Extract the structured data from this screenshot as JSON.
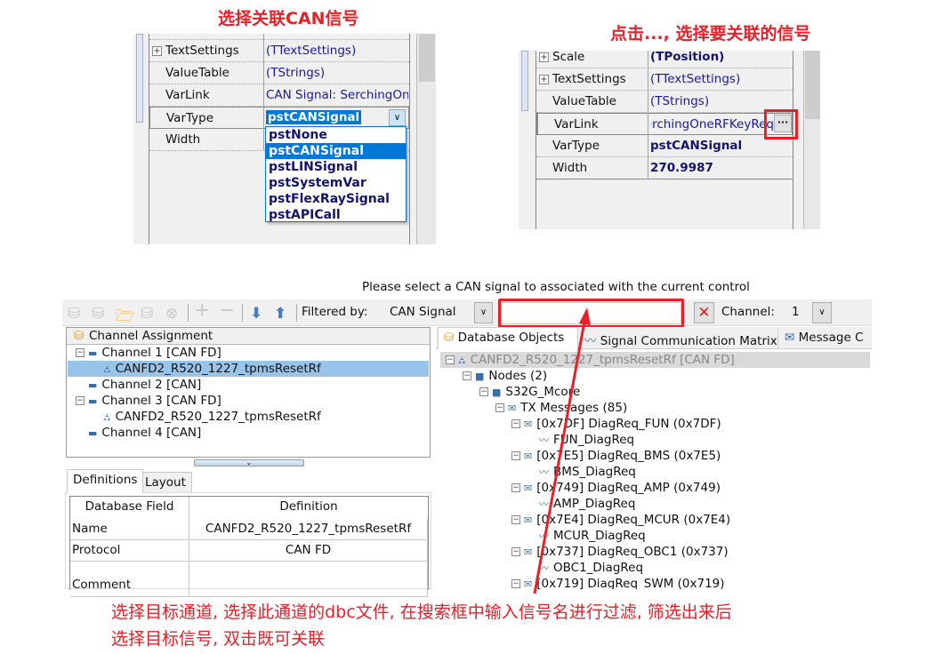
{
  "annotations": {
    "top_left": "选择关联CAN信号",
    "top_right": "点击..., 选择要关联的信号",
    "bottom_line1": "选择目标通道, 选择此通道的dbc文件, 在搜索框中输入信号名进行过滤, 筛选出来后",
    "bottom_line2": "选择目标信号, 双击既可关联",
    "accent_color": "#e8202a"
  },
  "property_grid_1": {
    "rows": [
      {
        "name": "TextSettings",
        "value": "(TTextSettings)",
        "expandable": true
      },
      {
        "name": "ValueTable",
        "value": "(TStrings)"
      },
      {
        "name": "VarLink",
        "value": "CAN Signal: SerchingOne"
      },
      {
        "name": "VarType",
        "value": "pstCANSignal"
      },
      {
        "name": "Width",
        "value": ""
      }
    ],
    "dropdown_options": [
      "pstNone",
      "pstCANSignal",
      "pstLINSignal",
      "pstSystemVar",
      "pstFlexRaySignal",
      "pstAPICall"
    ],
    "selected_option": "pstCANSignal"
  },
  "property_grid_2": {
    "rows": [
      {
        "name": "Scale",
        "value": "(TPosition)",
        "expandable": true
      },
      {
        "name": "TextSettings",
        "value": "(TTextSettings)",
        "expandable": true
      },
      {
        "name": "ValueTable",
        "value": "(TStrings)"
      },
      {
        "name": "VarLink",
        "value": "erchingOneRFKeyReq"
      },
      {
        "name": "VarType",
        "value": "pstCANSignal"
      },
      {
        "name": "Width",
        "value": "270.9987"
      }
    ],
    "ellipsis_button": "···"
  },
  "dialog": {
    "caption": "Please select a CAN signal to associated with the current control",
    "filtered_by_label": "Filtered by:",
    "filter_value": "CAN Signal",
    "search_value": "",
    "channel_label": "Channel:",
    "channel_value": "1",
    "channel_tree": {
      "header": "Channel Assignment",
      "items": [
        "Channel 1 [CAN FD]",
        "CANFD2_R520_1227_tpmsResetRf",
        "Channel 2 [CAN]",
        "Channel 3 [CAN FD]",
        "CANFD2_R520_1227_tpmsResetRf",
        "Channel 4 [CAN]"
      ]
    },
    "bottom_tabs": [
      "Definitions",
      "Layout"
    ],
    "definitions": {
      "headers": [
        "Database Field",
        "Definition"
      ],
      "rows": [
        [
          "Name",
          "CANFD2_R520_1227_tpmsResetRf"
        ],
        [
          "Protocol",
          "CAN FD"
        ],
        [
          "Comment",
          ""
        ]
      ]
    },
    "right_tabs": [
      "Database Objects",
      "Signal Communication Matrix",
      "Message C"
    ],
    "db_tree": [
      "CANFD2_R520_1227_tpmsResetRf [CAN FD]",
      "Nodes (2)",
      "S32G_Mcore",
      "TX Messages (85)",
      "[0x7DF] DiagReq_FUN (0x7DF)",
      "FUN_DiagReq",
      "[0x7E5] DiagReq_BMS (0x7E5)",
      "BMS_DiagReq",
      "[0x749] DiagReq_AMP (0x749)",
      "AMP_DiagReq",
      "[0x7E4] DiagReq_MCUR (0x7E4)",
      "MCUR_DiagReq",
      "[0x737] DiagReq_OBC1 (0x737)",
      "OBC1_DiagReq",
      "[0x719] DiagReq_SWM (0x719)"
    ]
  }
}
